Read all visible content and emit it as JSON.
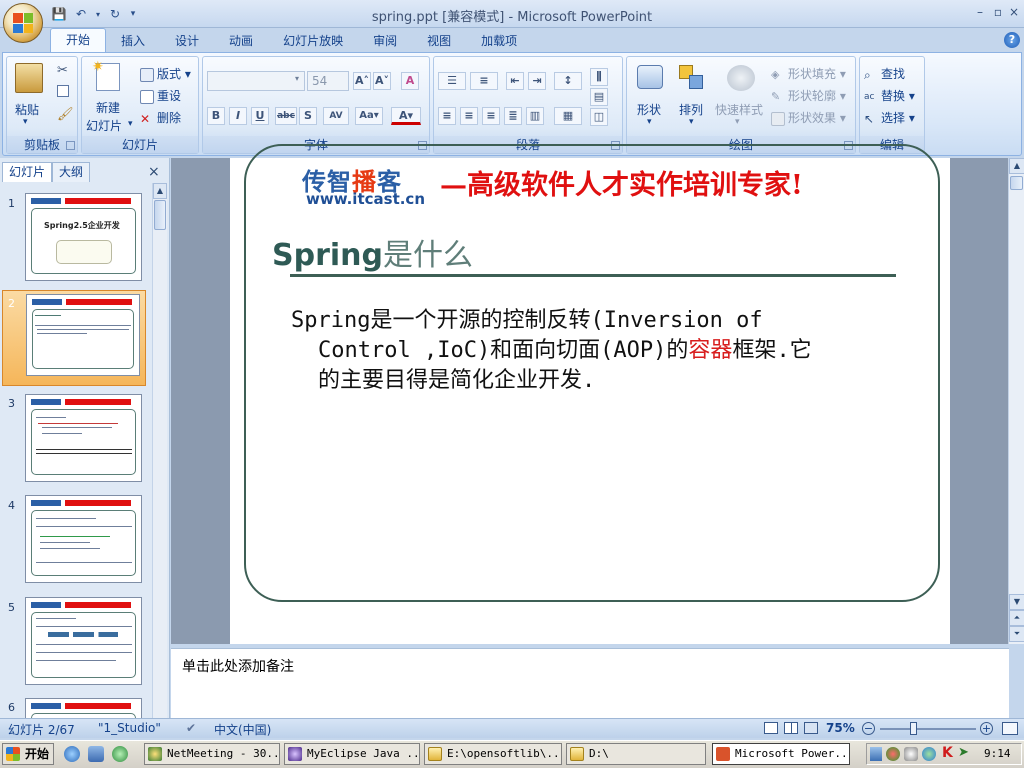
{
  "window": {
    "title": "spring.ppt [兼容模式] - Microsoft PowerPoint",
    "minimize": "–",
    "maximize": "▫",
    "close": "×"
  },
  "ribbon_tabs": [
    "开始",
    "插入",
    "设计",
    "动画",
    "幻灯片放映",
    "审阅",
    "视图",
    "加载项"
  ],
  "ribbon": {
    "clipboard": {
      "label": "剪贴板",
      "paste": "粘贴"
    },
    "slides": {
      "label": "幻灯片",
      "new_slide_line1": "新建",
      "new_slide_line2": "幻灯片",
      "layout": "版式",
      "reset": "重设",
      "delete": "删除"
    },
    "font": {
      "label": "字体",
      "font_name": "",
      "font_size": "54"
    },
    "paragraph": {
      "label": "段落"
    },
    "drawing": {
      "label": "绘图",
      "shapes": "形状",
      "arrange": "排列",
      "quick_styles": "快速样式",
      "shape_fill": "形状填充",
      "shape_outline": "形状轮廓",
      "shape_effects": "形状效果"
    },
    "editing": {
      "label": "编辑",
      "find": "查找",
      "replace": "替换",
      "select": "选择"
    }
  },
  "panel": {
    "tab_slides": "幻灯片",
    "tab_outline": "大纲",
    "close": "×",
    "thumb1_title": "Spring2.5企业开发",
    "thumb_numbers": [
      "1",
      "2",
      "3",
      "4",
      "5",
      "6"
    ]
  },
  "slide": {
    "logo_brand_1": "传智",
    "logo_brand_2": "播",
    "logo_brand_3": "客",
    "logo_url": "www.itcast.cn",
    "slogan": "—高级软件人才实作培训专家!",
    "title_en": "Spring",
    "title_cn": "是什么",
    "body_line1": "Spring是一个开源的控制反转(Inversion of",
    "body_line2a": "Control ,IoC)和面向切面(AOP)的",
    "body_line2_red": "容器",
    "body_line2b": "框架.它",
    "body_line3": "的主要目得是简化企业开发."
  },
  "notes": {
    "placeholder": "单击此处添加备注"
  },
  "status": {
    "slide_counter": "幻灯片 2/67",
    "theme": "\"1_Studio\"",
    "language": "中文(中国)",
    "zoom": "75%"
  },
  "taskbar": {
    "start": "开始",
    "buttons": [
      "NetMeeting - 30...",
      "MyEclipse Java ...",
      "E:\\opensoftlib\\...",
      "D:\\",
      "Microsoft Power..."
    ],
    "clock": "9:14"
  },
  "colors": {
    "accent": "#15428b",
    "slogan_red": "#e01010",
    "frame_green": "#3d5f55"
  }
}
